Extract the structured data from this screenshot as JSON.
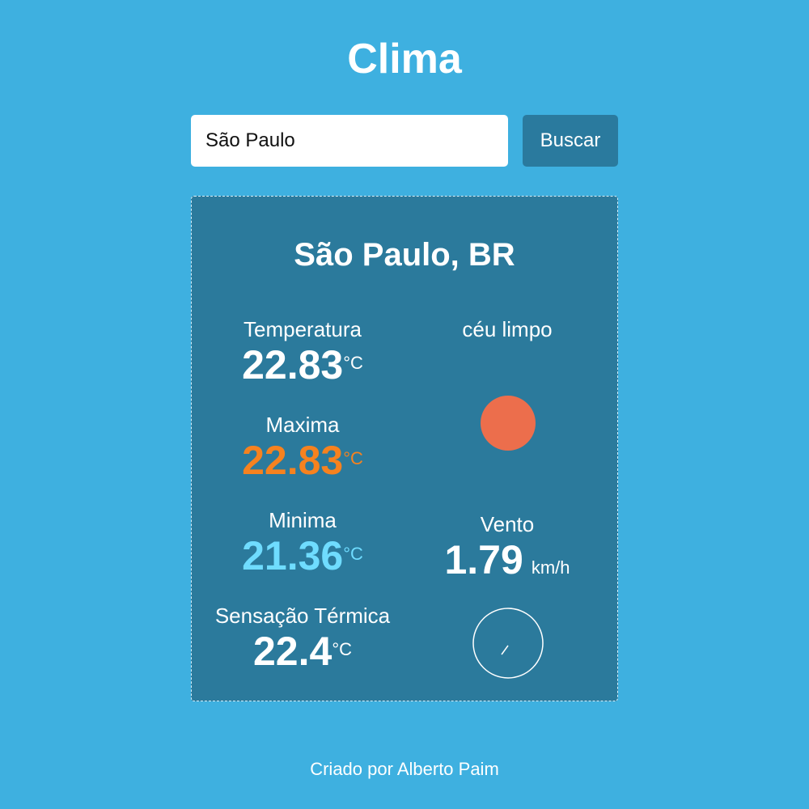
{
  "header": {
    "title": "Clima"
  },
  "search": {
    "value": "São Paulo",
    "button_label": "Buscar"
  },
  "weather": {
    "location": "São Paulo, BR",
    "temperature": {
      "label": "Temperatura",
      "value": "22.83",
      "unit": "°C"
    },
    "max": {
      "label": "Maxima",
      "value": "22.83",
      "unit": "°C"
    },
    "min": {
      "label": "Minima",
      "value": "21.36",
      "unit": "°C"
    },
    "feels_like": {
      "label": "Sensação Térmica",
      "value": "22.4",
      "unit": "°C"
    },
    "description": "céu limpo",
    "wind": {
      "label": "Vento",
      "value": "1.79",
      "unit": "km/h"
    },
    "icons": {
      "condition": "sun-icon",
      "wind_direction": "compass-icon"
    },
    "colors": {
      "max": "#f6821f",
      "min": "#6fdcff",
      "sun": "#ec6e4c"
    }
  },
  "footer": {
    "credit": "Criado por Alberto Paim"
  },
  "colors": {
    "background": "#3eb0e0",
    "card": "#2b7a9c",
    "button": "#2a7a9e"
  }
}
